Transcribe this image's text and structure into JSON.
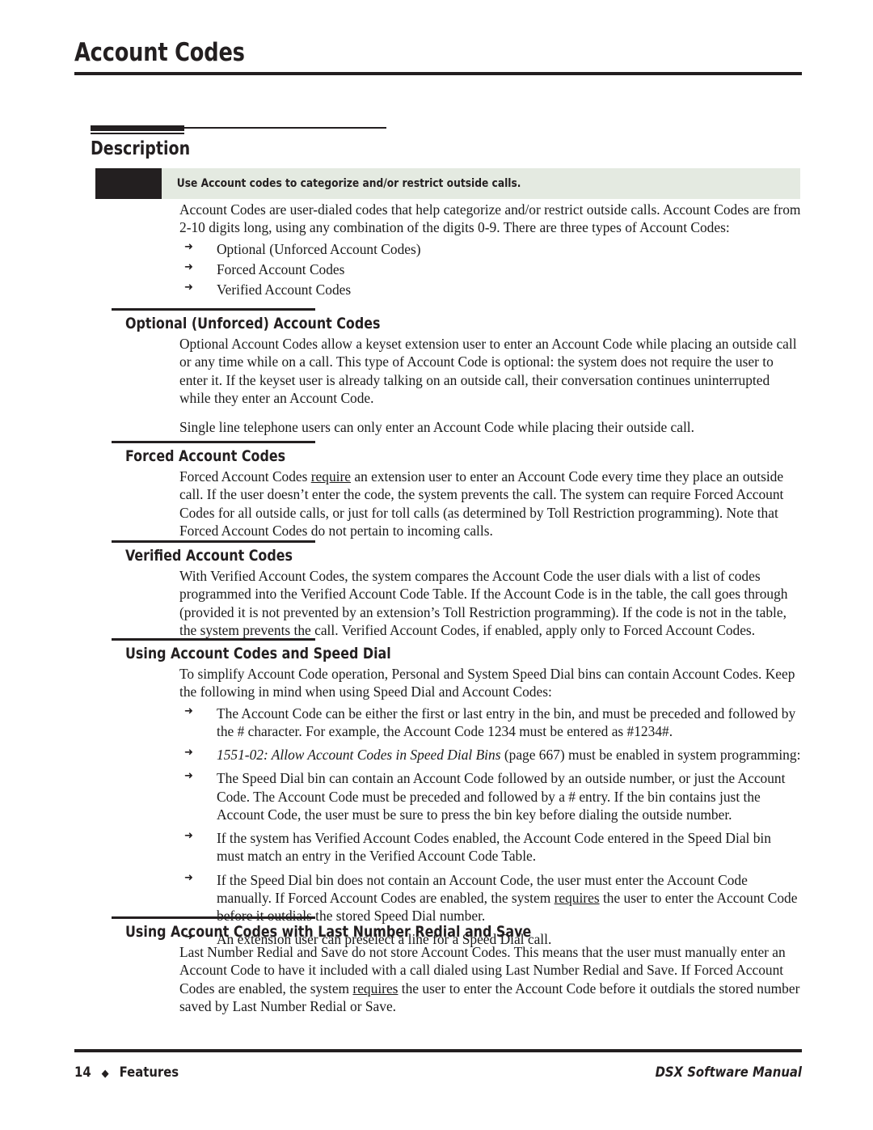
{
  "page": {
    "title": "Account Codes"
  },
  "section": {
    "title": "Description",
    "callout": "Use Account codes to categorize and/or restrict outside calls.",
    "intro": "Account Codes are user-dialed codes that help categorize and/or restrict outside calls. Account Codes are from 2-10 digits long, using any combination of the digits 0-9. There are three types of Account Codes:",
    "types": [
      "Optional (Unforced Account Codes)",
      "Forced Account Codes",
      "Verified Account Codes"
    ],
    "bullet_glyph": "➜"
  },
  "subsections": {
    "optional": {
      "title": "Optional (Unforced) Account Codes",
      "para1": "Optional Account Codes allow a keyset extension user to enter an Account Code while placing an outside call or any time while on a call. This type of Account Code is optional: the system does not require the user to enter it. If the keyset user is already talking on an outside call, their conversation continues uninterrupted while they enter an Account Code.",
      "para2": "Single line telephone users can only enter an Account Code while placing their outside call."
    },
    "forced": {
      "title": "Forced Account Codes",
      "para_a": "Forced Account Codes ",
      "para_underlined": "require",
      "para_b": " an extension user to enter an Account Code every time they place an outside call. If the user doesn’t enter the code, the system prevents the call. The system can require Forced Account Codes for all outside calls, or just for toll calls (as determined by Toll Restriction programming). Note that Forced Account Codes do not pertain to incoming calls."
    },
    "verified": {
      "title": "Verified Account Codes",
      "para": "With Verified Account Codes, the system compares the Account Code the user dials with a list of codes programmed into the Verified Account Code Table. If the Account Code is in the table, the call goes through (provided it is not prevented by an extension’s Toll Restriction programming). If the code is not in the table, the system prevents the call. Verified Account Codes, if enabled, apply only to Forced Account Codes."
    },
    "speed_dial": {
      "title": "Using Account Codes and Speed Dial",
      "para": "To simplify Account Code operation, Personal and System Speed Dial bins can contain Account Codes. Keep the following in mind when using Speed Dial and Account Codes:",
      "bullet1": "The Account Code can be either the first or last entry in the bin, and must be preceded and followed by the # character. For example, the Account Code 1234 must be entered as #1234#.",
      "bullet2_italic": "1551-02: Allow Account Codes in Speed Dial Bins",
      "bullet2_rest": " (page 667) must be enabled in system programming:",
      "bullet3": "The Speed Dial bin can contain an Account Code followed by an outside number, or just the Account Code. The Account Code must be preceded and followed by a # entry. If the bin contains just the Account Code, the user must be sure to press the bin key before dialing the outside number.",
      "bullet4": "If the system has Verified Account Codes enabled, the Account Code entered in the Speed Dial bin must match an entry in the Verified Account Code Table.",
      "bullet5_a": "If the Speed Dial bin does not contain an Account Code, the user must enter the Account Code manually. If Forced Account Codes are enabled, the system ",
      "bullet5_underlined": "requires",
      "bullet5_b": " the user to enter the Account Code before it outdials the stored Speed Dial number.",
      "bullet6": "An extension user can preselect a line for a Speed Dial call."
    },
    "redial": {
      "title": "Using Account Codes with Last Number Redial and Save",
      "para_a": "Last Number Redial and Save do not store Account Codes. This means that the user must manually enter an Account Code to have it included with a call dialed using Last Number Redial and Save. If Forced Account Codes are enabled, the system ",
      "para_underlined": "requires",
      "para_b": " the user to enter the Account Code before it outdials the stored number saved by Last Number Redial or Save."
    }
  },
  "footer": {
    "page_number": "14",
    "diamond": "◆",
    "section_label": "Features",
    "manual_title": "DSX Software Manual"
  },
  "colors": {
    "ink": "#231f20",
    "callout_band": "#e4eae1",
    "callout_swatch": "#231f20"
  }
}
